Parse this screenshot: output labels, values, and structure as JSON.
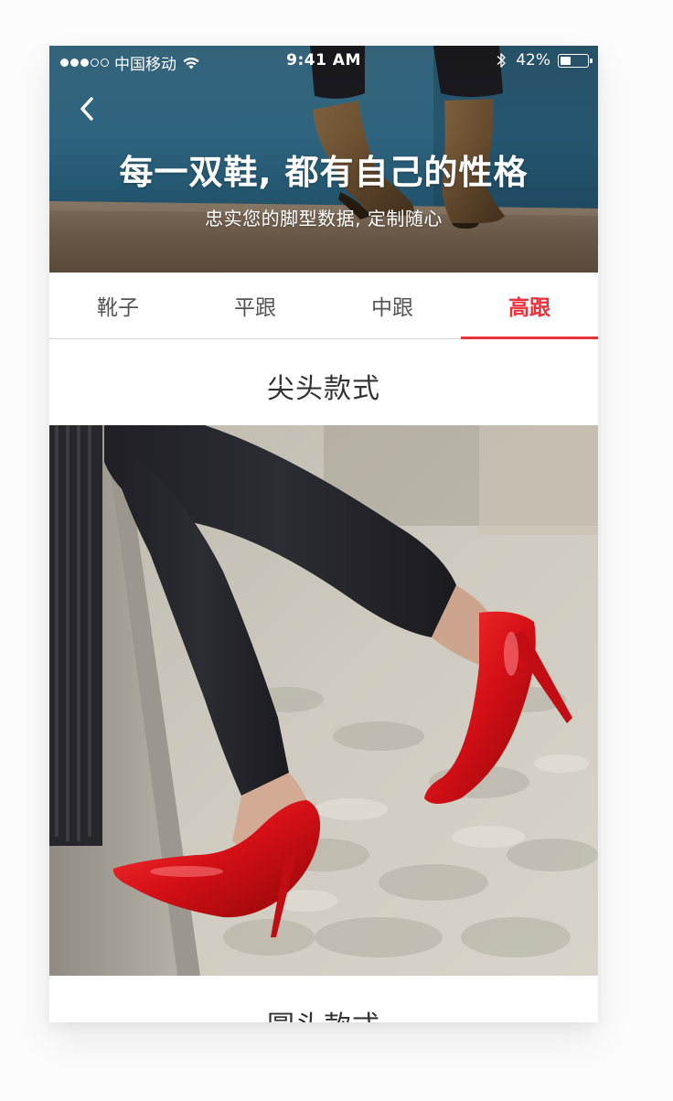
{
  "status_bar": {
    "signal_full": 3,
    "signal_empty": 2,
    "carrier": "中国移动",
    "time": "9:41 AM",
    "battery_percent": "42%",
    "battery_level": 0.42,
    "icons": [
      "wifi-icon",
      "bluetooth-icon",
      "battery-icon"
    ]
  },
  "header": {
    "back_icon": "chevron-left-icon",
    "title": "每一双鞋, 都有自己的性格",
    "subtitle": "忠实您的脚型数据, 定制随心"
  },
  "tabs": [
    {
      "label": "靴子",
      "active": false
    },
    {
      "label": "平跟",
      "active": false
    },
    {
      "label": "中跟",
      "active": false
    },
    {
      "label": "高跟",
      "active": true
    }
  ],
  "sections": [
    {
      "title": "尖头款式"
    },
    {
      "title": "圆头款式"
    }
  ],
  "colors": {
    "accent": "#e8333c",
    "tab_text": "#555555",
    "title_text": "#333333",
    "shoe_red": "#d40f16"
  }
}
